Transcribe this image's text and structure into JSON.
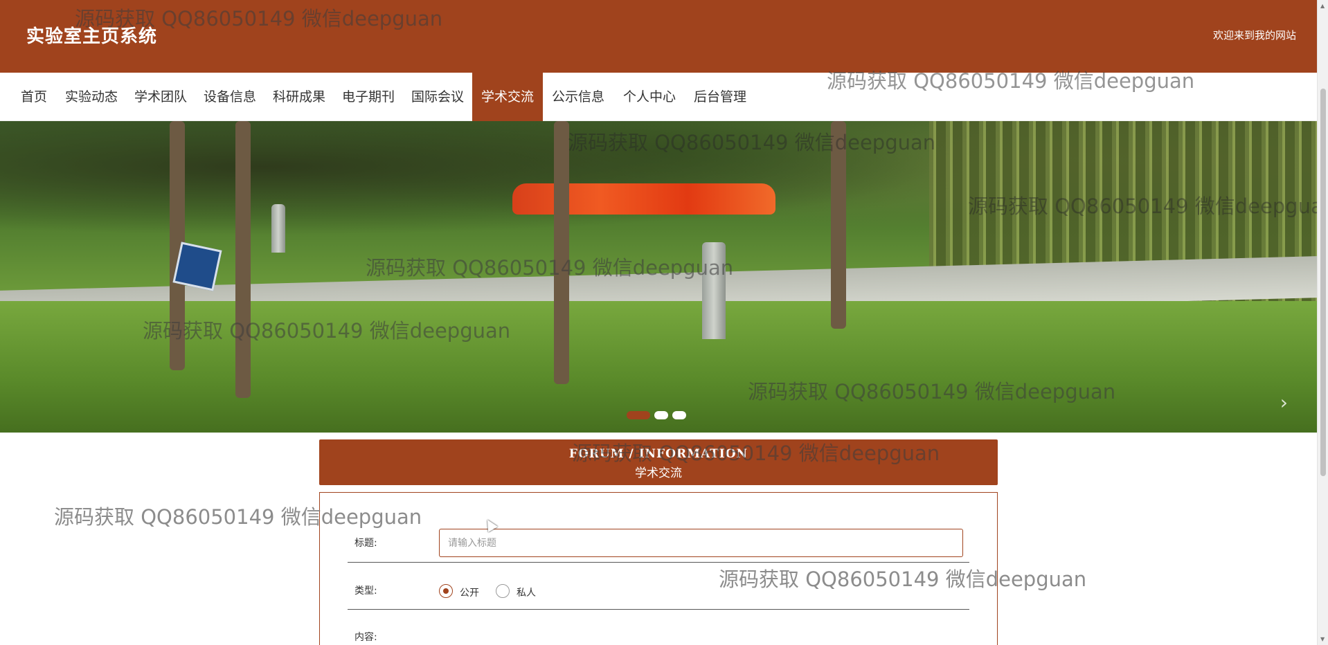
{
  "header": {
    "site_title": "实验室主页系统",
    "welcome_text": "欢迎来到我的网站"
  },
  "nav": {
    "items": [
      {
        "label": "首页"
      },
      {
        "label": "实验动态"
      },
      {
        "label": "学术团队"
      },
      {
        "label": "设备信息"
      },
      {
        "label": "科研成果"
      },
      {
        "label": "电子期刊"
      },
      {
        "label": "国际会议"
      },
      {
        "label": "学术交流",
        "active": true
      },
      {
        "label": "公示信息"
      },
      {
        "label": "个人中心"
      },
      {
        "label": "后台管理"
      }
    ]
  },
  "banner": {
    "slide_count": 3,
    "active_slide": 1,
    "next_arrow": "›"
  },
  "panel": {
    "heading_en": "FORUM / INFORMATION",
    "heading_cn": "学术交流"
  },
  "form": {
    "title_label": "标题:",
    "title_placeholder": "请输入标题",
    "title_value": "",
    "type_label": "类型:",
    "type_options": [
      {
        "label": "公开",
        "checked": true
      },
      {
        "label": "私人",
        "checked": false
      }
    ],
    "content_label": "内容:"
  },
  "watermark": {
    "text": "源码获取 QQ86050149 微信deepguan"
  },
  "colors": {
    "brand": "#a0431d",
    "header_text": "#ffffff",
    "watermark": "#666666"
  }
}
